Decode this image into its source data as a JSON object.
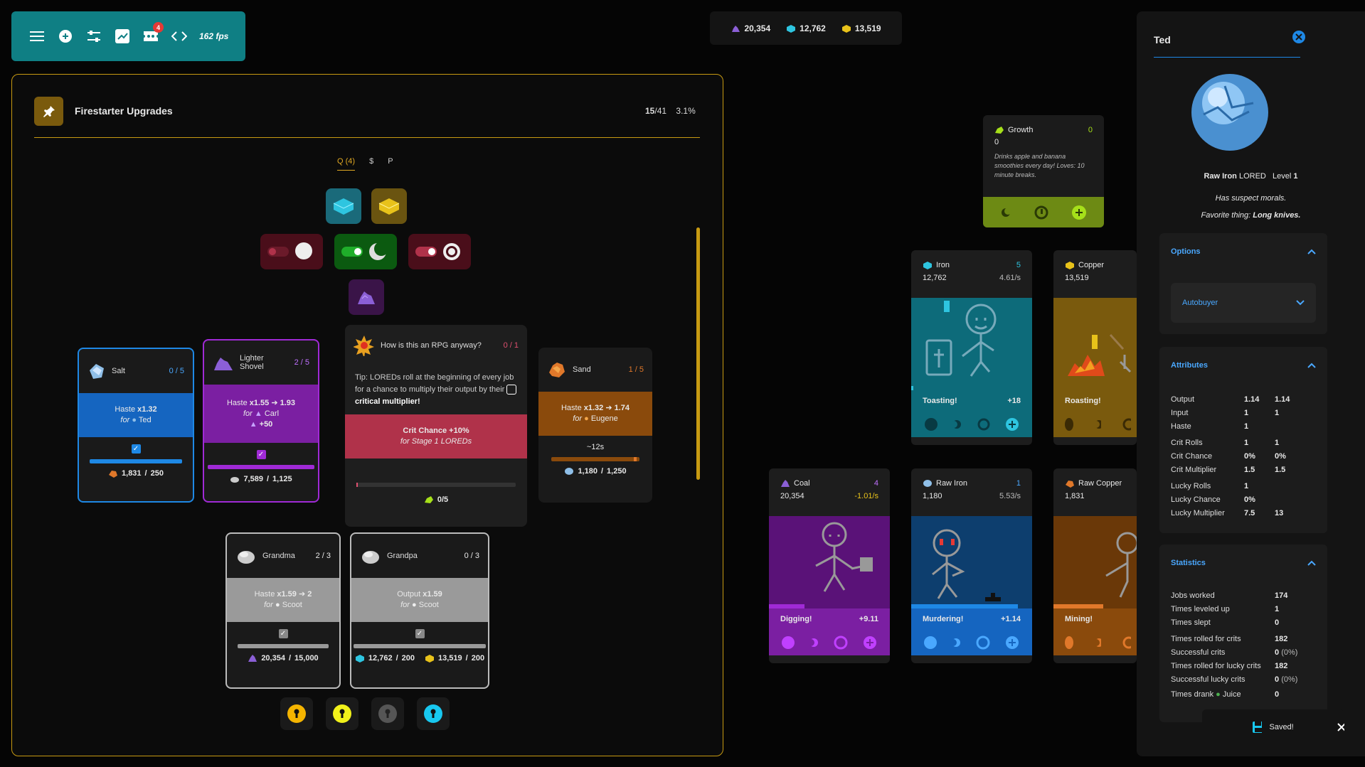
{
  "topbar": {
    "icons": [
      "menu-icon",
      "add-circle-icon",
      "sliders-icon",
      "chart-icon",
      "ticket-icon",
      "code-icon"
    ],
    "badge": "4",
    "fps": "162 fps"
  },
  "currency": {
    "coal": "20,354",
    "iron": "12,762",
    "copper": "13,519"
  },
  "upgrades": {
    "title": "Firestarter Upgrades",
    "count_bold": "15",
    "count_rest": "/41",
    "percent": "3.1%",
    "tabs": [
      "Q (4)",
      "$",
      "P"
    ],
    "cards": {
      "salt": {
        "name": "Salt",
        "level": "0 / 5",
        "line1": "Haste ",
        "line1b": "x1.32",
        "line2": "for ",
        "line2b": "Ted",
        "cost": "1,831",
        "cost_max": "250"
      },
      "shovel": {
        "name": "Lighter Shovel",
        "level": "2 / 5",
        "line1": "Haste ",
        "line1b": "x1.55",
        "arrow": " ➔ ",
        "line1c": "1.93",
        "line2": "for ",
        "line2b": "Carl",
        "line3": "+50",
        "cost": "7,589",
        "cost_max": "1,125"
      },
      "rpg": {
        "name": "How is this an RPG anyway?",
        "level": "0 / 1",
        "tip": "Tip: LOREDs roll at the beginning of every job for a chance to multiply their output by their",
        "tipb": "critical multiplier!",
        "line1": "Crit Chance +10%",
        "line2": "for Stage 1 LOREDs",
        "cost": "0/5"
      },
      "sand": {
        "name": "Sand",
        "level": "1 / 5",
        "line1": "Haste ",
        "line1b": "x1.32",
        "arrow": " ➔ ",
        "line1c": "1.74",
        "line2": "for ",
        "line2b": "Eugene",
        "timer": "~12s",
        "cost": "1,180",
        "cost_max": "1,250"
      },
      "grandma": {
        "name": "Grandma",
        "level": "2 / 3",
        "line1": "Haste ",
        "line1b": "x1.59",
        "arrow": " ➔ ",
        "line1c": "2",
        "line2": "for ",
        "line2b": "Scoot",
        "cost": "20,354",
        "cost_max": "15,000"
      },
      "grandpa": {
        "name": "Grandpa",
        "level": "0 / 3",
        "line1": "Output ",
        "line1b": "x1.59",
        "line2": "for ",
        "line2b": "Scoot",
        "cost1": "12,762",
        "cost1_max": "200",
        "cost2": "13,519",
        "cost2_max": "200"
      }
    }
  },
  "loreds": {
    "growth": {
      "name": "Growth",
      "level": "0",
      "amount": "0",
      "desc": "Drinks apple and banana smoothies every day! Loves: 10 minute breaks."
    },
    "iron": {
      "name": "Iron",
      "level": "5",
      "amount": "12,762",
      "rate": "4.61/s",
      "status": "Toasting!",
      "gain": "+18"
    },
    "copper": {
      "name": "Copper",
      "amount": "13,519",
      "status": "Roasting!"
    },
    "coal": {
      "name": "Coal",
      "level": "4",
      "amount": "20,354",
      "rate": "-1.01/s",
      "status": "Digging!",
      "gain": "+9.11"
    },
    "raw_iron": {
      "name": "Raw Iron",
      "level": "1",
      "amount": "1,180",
      "rate": "5.53/s",
      "status": "Murdering!",
      "gain": "+1.14"
    },
    "raw_copper": {
      "name": "Raw Copper",
      "amount": "1,831",
      "status": "Mining!"
    }
  },
  "ted": {
    "name": "Ted",
    "lored_name": "Raw Iron",
    "lored_word": "LORED",
    "level_label": "Level",
    "level": "1",
    "trait": "Has suspect morals.",
    "fav_label": "Favorite thing:",
    "fav": "Long knives.",
    "options_title": "Options",
    "autobuyer": "Autobuyer",
    "attributes_title": "Attributes",
    "attributes": [
      {
        "k": "Output",
        "v": "1.14",
        "v2": "1.14"
      },
      {
        "k": "Input",
        "v": "1",
        "v2": "1"
      },
      {
        "k": "Haste",
        "v": "1",
        "v2": ""
      },
      {
        "k": "Crit Rolls",
        "v": "1",
        "v2": "1"
      },
      {
        "k": "Crit Chance",
        "v": "0%",
        "v2": "0%"
      },
      {
        "k": "Crit Multiplier",
        "v": "1.5",
        "v2": "1.5"
      },
      {
        "k": "Lucky Rolls",
        "v": "1",
        "v2": ""
      },
      {
        "k": "Lucky Chance",
        "v": "0%",
        "v2": ""
      },
      {
        "k": "Lucky Multiplier",
        "v": "7.5",
        "v2": "13"
      }
    ],
    "statistics_title": "Statistics",
    "statistics": [
      {
        "k": "Jobs worked",
        "v": "174",
        "v2": ""
      },
      {
        "k": "Times leveled up",
        "v": "1",
        "v2": ""
      },
      {
        "k": "Times slept",
        "v": "0",
        "v2": ""
      },
      {
        "k": "Times rolled for crits",
        "v": "182",
        "v2": ""
      },
      {
        "k": "Successful crits",
        "v": "0",
        "v2": "(0%)"
      },
      {
        "k": "Times rolled for lucky crits",
        "v": "182",
        "v2": ""
      },
      {
        "k": "Successful lucky crits",
        "v": "0",
        "v2": "(0%)"
      },
      {
        "k": "Times drank",
        "kb": "Juice",
        "v": "0",
        "v2": ""
      }
    ]
  },
  "saved": "Saved!",
  "colors": {
    "teal": "#0f7f84",
    "gold": "#c79a12",
    "blue": "#1565c0",
    "purple": "#7b1fa2",
    "crimson": "#b0324a",
    "orange": "#8a4a0c",
    "grey": "#9a9a9a"
  }
}
